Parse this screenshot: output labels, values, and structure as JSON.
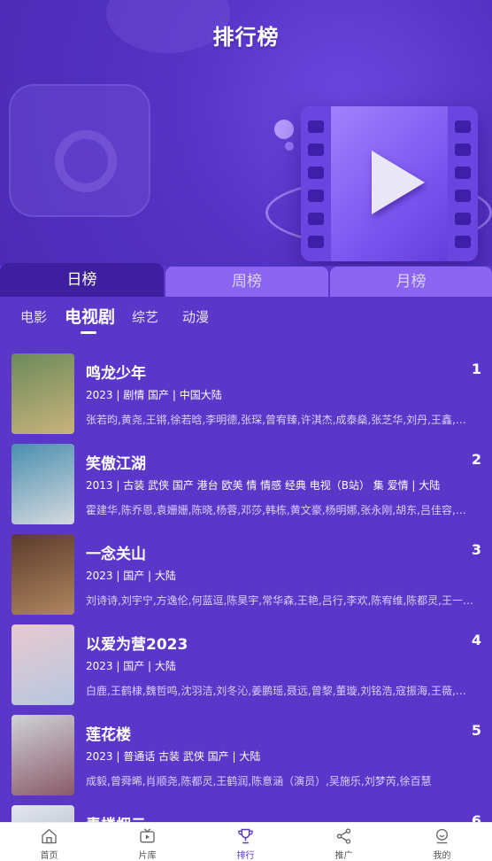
{
  "page": {
    "title": "排行榜"
  },
  "period_tabs": [
    {
      "label": "日榜",
      "active": true
    },
    {
      "label": "周榜",
      "active": false
    },
    {
      "label": "月榜",
      "active": false
    }
  ],
  "categories": [
    {
      "label": "电影",
      "active": false
    },
    {
      "label": "电视剧",
      "active": true
    },
    {
      "label": "综艺",
      "active": false
    },
    {
      "label": "动漫",
      "active": false
    }
  ],
  "rankings": [
    {
      "rank": "1",
      "title": "鸣龙少年",
      "meta": "2023 | 剧情 国产 | 中国大陆",
      "cast": "张若昀,黄尧,王锵,徐若晗,李明德,张琛,曾宥臻,许淇杰,成泰燊,张芝华,刘丹,王鑫,…",
      "poster_colors": [
        "#6b8a5a",
        "#c9b37c"
      ]
    },
    {
      "rank": "2",
      "title": "笑傲江湖",
      "meta": "2013 | 古装 武侠 国产 港台 欧美 情 情感 经典 电视（B站） 集 爱情 | 大陆",
      "cast": "霍建华,陈乔恩,袁姗姗,陈晓,杨蓉,邓莎,韩栋,黄文豪,杨明娜,张永刚,胡东,吕佳容,…",
      "poster_colors": [
        "#4a8fb0",
        "#d5d9de"
      ]
    },
    {
      "rank": "3",
      "title": "一念关山",
      "meta": "2023 | 国产 | 大陆",
      "cast": "刘诗诗,刘宇宁,方逸伦,何蓝逗,陈昊宇,常华森,王艳,吕行,李欢,陈宥维,陈都灵,王一…",
      "poster_colors": [
        "#5a3a2a",
        "#b08660"
      ]
    },
    {
      "rank": "4",
      "title": "以爱为营2023",
      "meta": "2023 | 国产 | 大陆",
      "cast": "白鹿,王鹤棣,魏哲鸣,沈羽洁,刘冬沁,姜鹏瑶,聂远,曾黎,董璇,刘铭浩,寇振海,王薇,…",
      "poster_colors": [
        "#e8c9cf",
        "#b7c7e0"
      ]
    },
    {
      "rank": "5",
      "title": "莲花楼",
      "meta": "2023 | 普通话 古装 武侠 国产 | 大陆",
      "cast": "成毅,曾舜晞,肖顺尧,陈都灵,王鹤润,陈意涵（演员）,吴施乐,刘梦芮,徐百慧",
      "poster_colors": [
        "#cfd2d6",
        "#8a5a6a"
      ]
    },
    {
      "rank": "6",
      "title": "青楼烟云",
      "meta": "",
      "cast": "",
      "poster_colors": [
        "#e3e6ee",
        "#a0aab8"
      ]
    }
  ],
  "bottom_nav": [
    {
      "label": "首页",
      "icon": "home-icon",
      "active": false
    },
    {
      "label": "片库",
      "icon": "tv-icon",
      "active": false
    },
    {
      "label": "排行",
      "icon": "trophy-icon",
      "active": true
    },
    {
      "label": "推广",
      "icon": "share-icon",
      "active": false
    },
    {
      "label": "我的",
      "icon": "profile-icon",
      "active": false
    }
  ],
  "colors": {
    "background": "#5a36c9",
    "active_tab": "#3d1f9f",
    "inactive_tab": "#8b64f2",
    "nav_active": "#5a36c9"
  }
}
